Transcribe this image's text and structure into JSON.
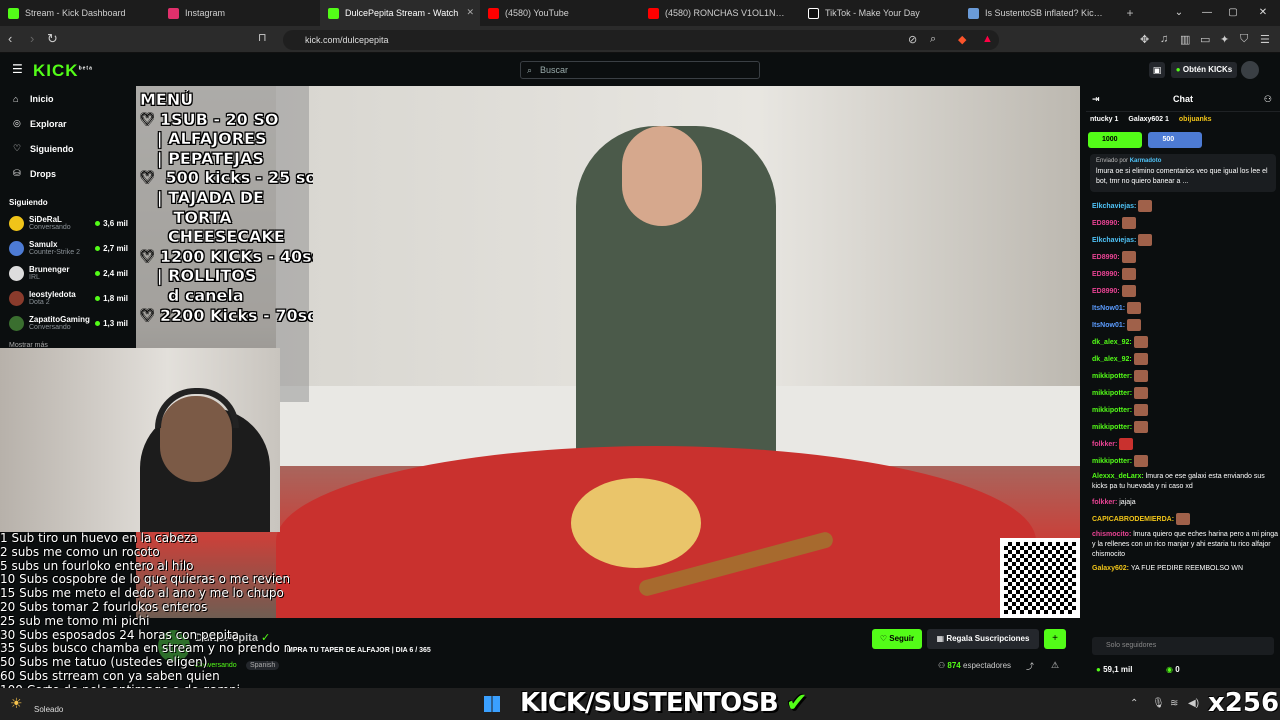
{
  "browser": {
    "tabs": [
      {
        "title": "Stream - Kick Dashboard",
        "color": "#53fc18"
      },
      {
        "title": "Instagram",
        "color": "#e1306c"
      },
      {
        "title": "DulcePepita Stream - Watch",
        "color": "#53fc18",
        "active": true
      },
      {
        "title": "(4580) YouTube",
        "color": "#ff0000"
      },
      {
        "title": "(4580) RONCHAS V1OL1N - PIURA",
        "color": "#ff0000"
      },
      {
        "title": "TikTok - Make Your Day",
        "color": "#ffffff"
      },
      {
        "title": "Is SustentoSB inflated? Kick eng",
        "color": "#6a9bd8"
      }
    ],
    "url": "kick.com/dulcepepita"
  },
  "kick": {
    "logo": "KICK",
    "logo_sup": "beta",
    "search_placeholder": "Buscar",
    "obtain_kicks": "Obtén KICKs"
  },
  "sidebar": {
    "nav": [
      {
        "label": "Inicio",
        "icon": "home-icon"
      },
      {
        "label": "Explorar",
        "icon": "compass-icon"
      },
      {
        "label": "Siguiendo",
        "icon": "heart-icon"
      },
      {
        "label": "Drops",
        "icon": "drops-icon"
      }
    ],
    "following_header": "Siguiendo",
    "channels": [
      {
        "name": "SiDeRaL",
        "game": "Conversando",
        "viewers": "3,6 mil",
        "color": "#f0c419"
      },
      {
        "name": "Samulx",
        "game": "Counter-Strike 2",
        "viewers": "2,7 mil",
        "color": "#4d7bd4"
      },
      {
        "name": "Brunenger",
        "game": "IRL",
        "viewers": "2,4 mil",
        "color": "#ddd"
      },
      {
        "name": "leostyledota",
        "game": "Dota 2",
        "viewers": "1,8 mil",
        "color": "#8a3b2c"
      },
      {
        "name": "ZapatitoGaming",
        "game": "Conversando",
        "viewers": "1,3 mil",
        "color": "#3a6e2f"
      }
    ],
    "show_more": "Mostrar más"
  },
  "video": {
    "menu_lines": [
      "MENÚ",
      "",
      "♡ 1SUB - 20 SO",
      "   | ALFAJORES",
      "   | PEPATEJAS",
      "♡  500 kicks - 25 so",
      "   | TAJADA DE",
      "      TORTA",
      "     CHEESECAKE",
      "♡ 1200 KICKs - 40so",
      "   | ROLLITOS",
      "     d canela",
      "♡ 2200 Kicks - 70so",
      "                                0so"
    ]
  },
  "overlay_subs": [
    "1 Sub tiro un huevo en la cabeza",
    "2 subs me como un rocoto",
    "5 subs un fourloko entero al hilo",
    "10 Subs cospobre de lo que quieras o me reviento u",
    "15 Subs me meto el dedo al ano y me lo chupo",
    "20 Subs tomar 2 fourlokos enteros",
    "25 sub me tomo mi pichi",
    "30 Subs esposados 24 horas con pepita",
    "35 Subs busco chamba en stream y no prendo mas",
    "50 Subs me tatuo (ustedes eligen)",
    "60 Subs strream con ya saben quien",
    "100 Corte de pelo antimage o de gampi"
  ],
  "stream_info": {
    "streamer": "DulcePepita",
    "title": "MPRA TU TAPER DE ALFAJOR | DIA 6 / 365",
    "category": "Conversando",
    "language": "Spanish",
    "follow": "Seguir",
    "gift": "Regala Suscripciones",
    "viewers_count": "874",
    "viewers_label": "espectadores"
  },
  "chat": {
    "title": "Chat",
    "top_gifters": [
      "ntucky 1",
      "Galaxy602 1",
      "obijuanks"
    ],
    "kick_buttons": [
      "1000",
      "500"
    ],
    "pinned_by_label": "Enviado por",
    "pinned_by_user": "Karmadoto",
    "pinned_text": "lmura oe si elimino comentarios veo que igual los lee el bot, tmr no quiero banear a ...",
    "messages": [
      {
        "user": "Elkchaviejas:",
        "color": "#4fc3f7",
        "text": ""
      },
      {
        "user": "ED8990:",
        "color": "#e84393",
        "text": ""
      },
      {
        "user": "Elkchaviejas:",
        "color": "#4fc3f7",
        "text": ""
      },
      {
        "user": "ED8990:",
        "color": "#e84393",
        "text": ""
      },
      {
        "user": "ED8990:",
        "color": "#e84393",
        "text": ""
      },
      {
        "user": "ED8990:",
        "color": "#e84393",
        "text": ""
      },
      {
        "user": "ItsNow01:",
        "color": "#5b9cff",
        "text": ""
      },
      {
        "user": "ItsNow01:",
        "color": "#5b9cff",
        "text": ""
      },
      {
        "user": "dk_alex_92:",
        "color": "#53fc18",
        "text": ""
      },
      {
        "user": "dk_alex_92:",
        "color": "#53fc18",
        "text": ""
      },
      {
        "user": "mikkipotter:",
        "color": "#53fc18",
        "text": ""
      },
      {
        "user": "mikkipotter:",
        "color": "#53fc18",
        "text": ""
      },
      {
        "user": "mikkipotter:",
        "color": "#53fc18",
        "text": ""
      },
      {
        "user": "mikkipotter:",
        "color": "#53fc18",
        "text": ""
      },
      {
        "user": "folkker:",
        "color": "#e84393",
        "text": ""
      },
      {
        "user": "mikkipotter:",
        "color": "#53fc18",
        "text": ""
      },
      {
        "user": "Alexxx_deLarx:",
        "color": "#53fc18",
        "text": "lmura oe ese galaxi esta enviando sus kicks pa tu huevada y ni caso xd"
      },
      {
        "user": "folkker:",
        "color": "#e84393",
        "text": "jajaja"
      },
      {
        "user": "CAPICABRODEMIERDA:",
        "color": "#f0c419",
        "text": ""
      },
      {
        "user": "chismocito:",
        "color": "#e84393",
        "text": "lmura quiero que eches harina pero a mi pinga y la rellenes con un rico manjar y ahi estaria tu rico alfajor chismocito"
      },
      {
        "user": "Galaxy602:",
        "color": "#f0c419",
        "text": "YA FUE PEDIRE REEMBOLSO WN"
      }
    ],
    "input_placeholder": "Solo seguidores",
    "kicks_count": "59,1 mil",
    "zero": "0"
  },
  "taskbar": {
    "weather": "Soleado",
    "banner": "KICK/SUSTENTOSB",
    "watermark": "x256"
  }
}
